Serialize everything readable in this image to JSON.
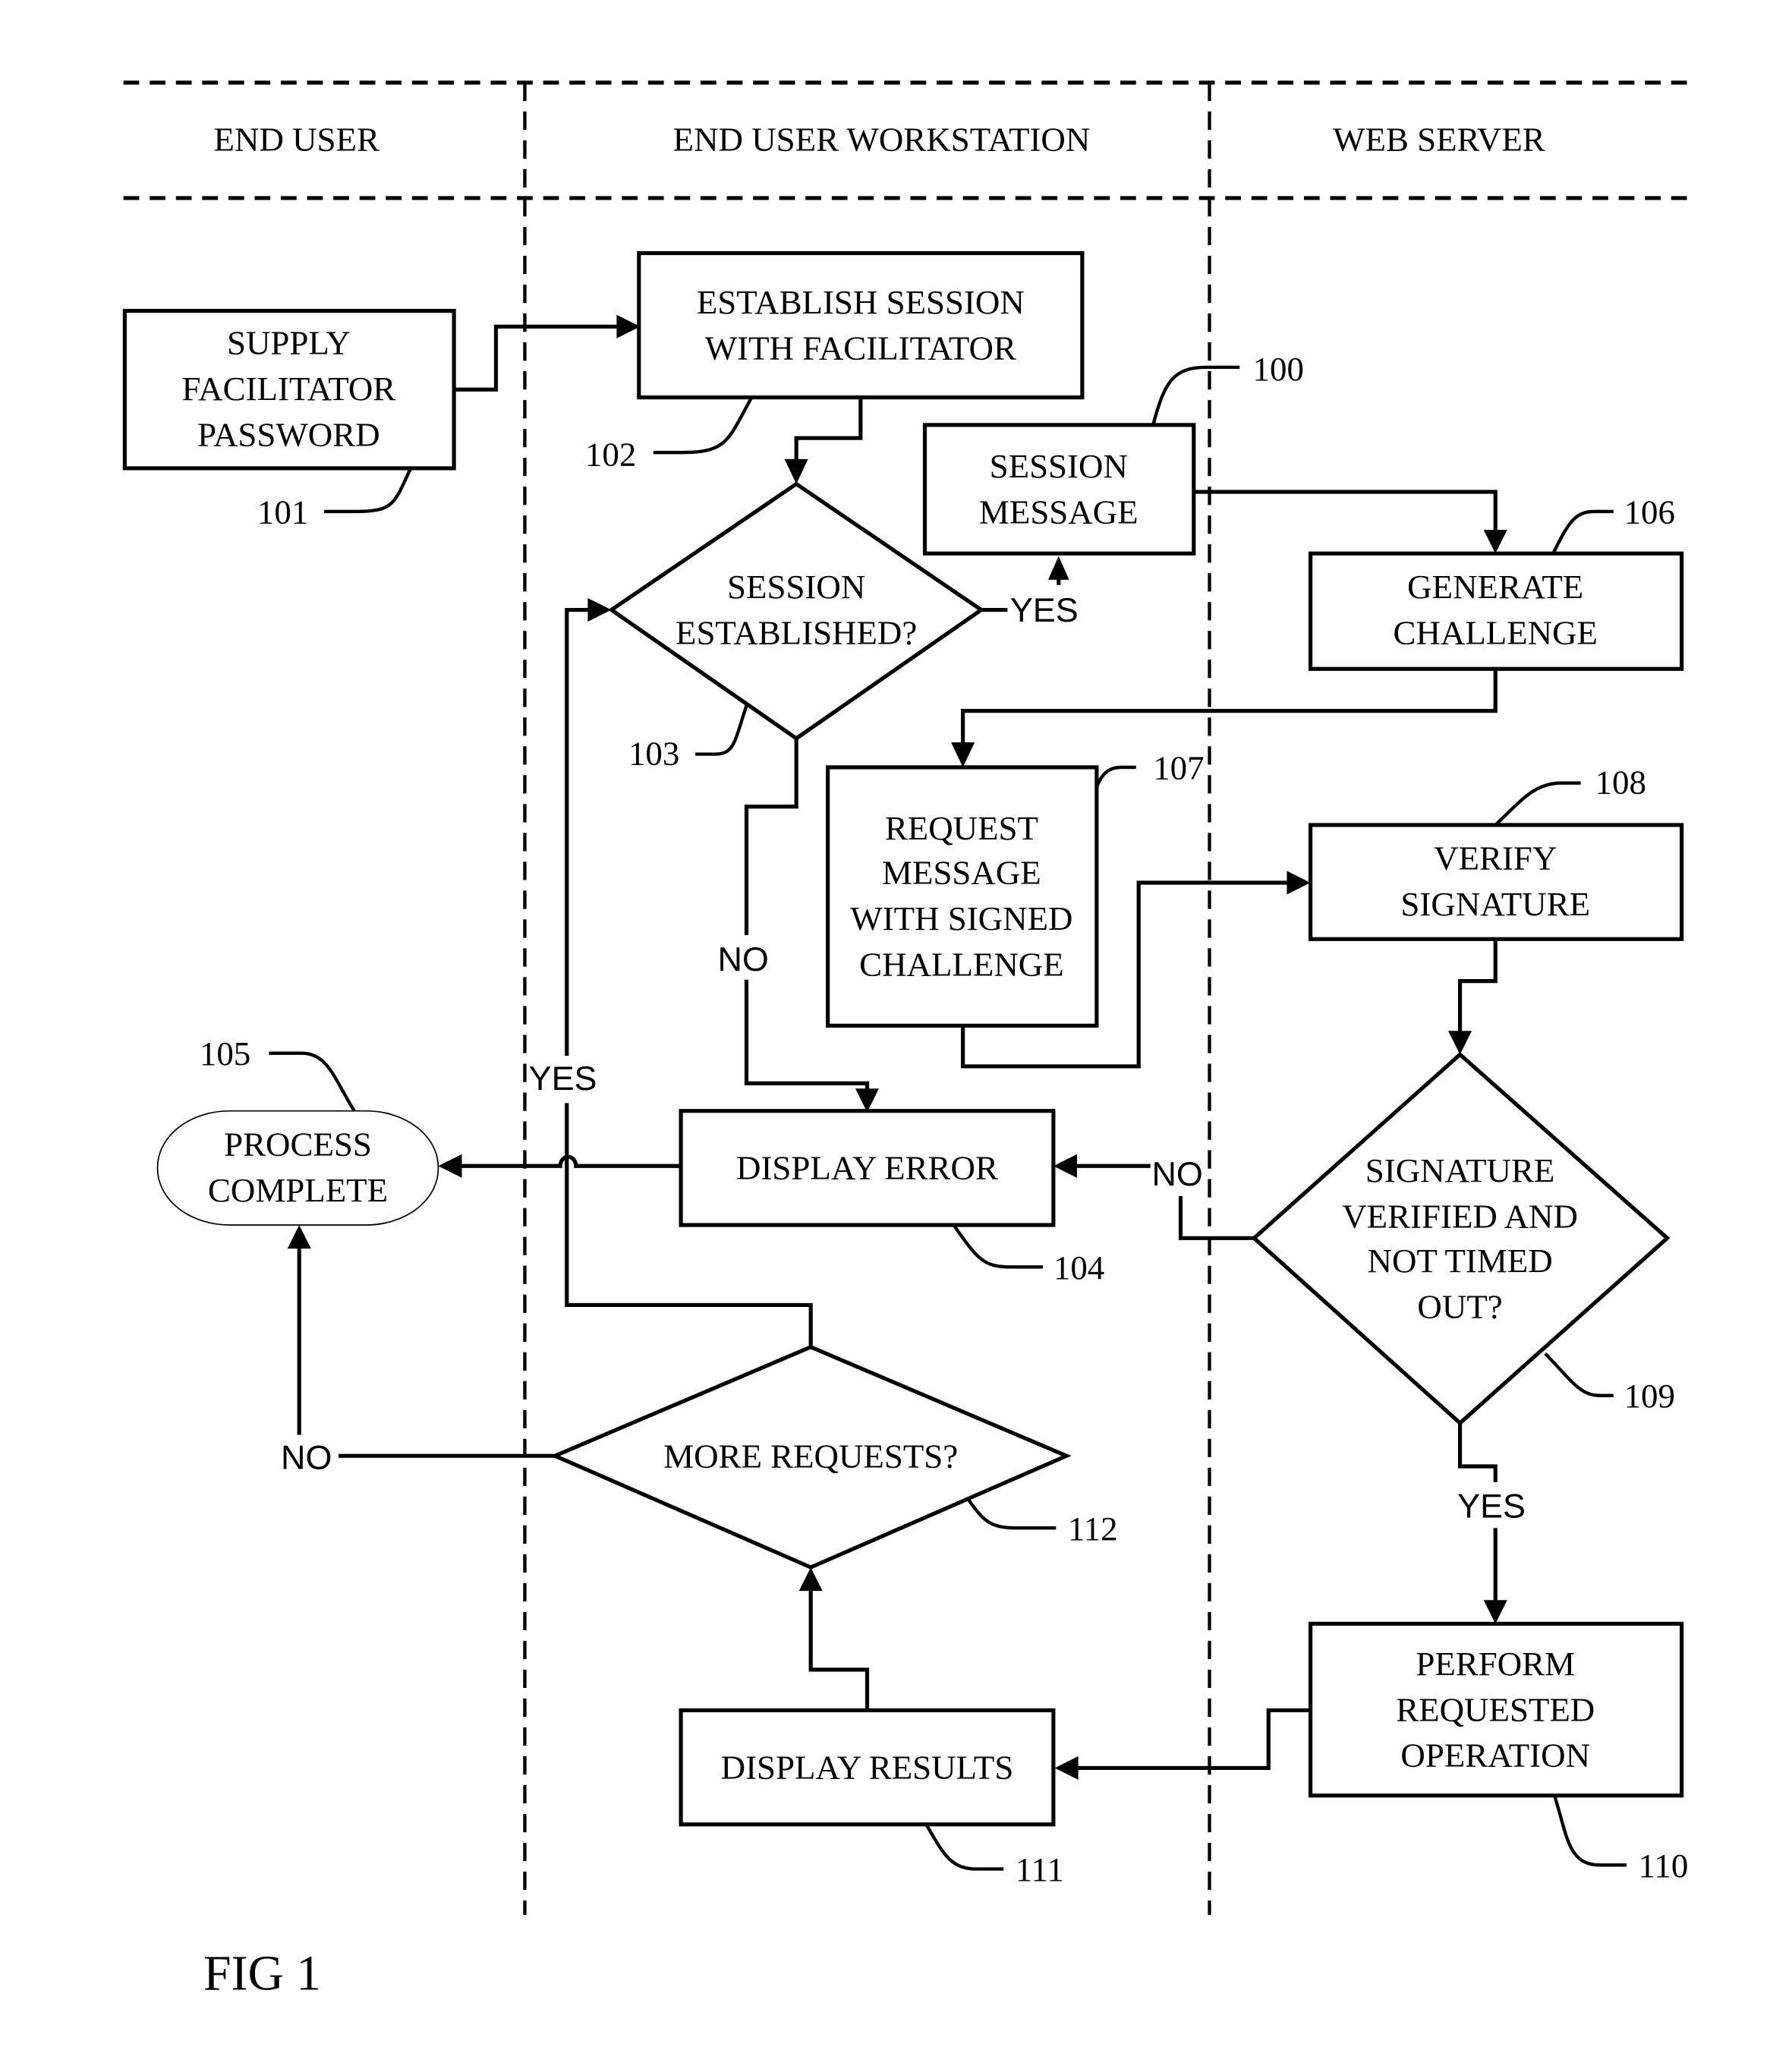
{
  "figure": {
    "caption": "FIG 1",
    "lanes": [
      {
        "id": "end-user",
        "label": "END USER"
      },
      {
        "id": "workstation",
        "label": "END USER WORKSTATION"
      },
      {
        "id": "web-server",
        "label": "WEB SERVER"
      }
    ],
    "nodes": {
      "n101": {
        "ref": "101",
        "type": "process",
        "lines": [
          "SUPPLY",
          "FACILITATOR",
          "PASSWORD"
        ]
      },
      "n102": {
        "ref": "102",
        "type": "process",
        "lines": [
          "ESTABLISH SESSION",
          "WITH FACILITATOR"
        ]
      },
      "n100": {
        "ref": "100",
        "type": "process",
        "lines": [
          "SESSION",
          "MESSAGE"
        ]
      },
      "n103": {
        "ref": "103",
        "type": "decision",
        "lines": [
          "SESSION",
          "ESTABLISHED?"
        ]
      },
      "n106": {
        "ref": "106",
        "type": "process",
        "lines": [
          "GENERATE",
          "CHALLENGE"
        ]
      },
      "n107": {
        "ref": "107",
        "type": "process",
        "lines": [
          "REQUEST",
          "MESSAGE",
          "WITH SIGNED",
          "CHALLENGE"
        ]
      },
      "n108": {
        "ref": "108",
        "type": "process",
        "lines": [
          "VERIFY",
          "SIGNATURE"
        ]
      },
      "n105": {
        "ref": "105",
        "type": "terminal",
        "lines": [
          "PROCESS",
          "COMPLETE"
        ]
      },
      "n104": {
        "ref": "104",
        "type": "process",
        "lines": [
          "DISPLAY ERROR"
        ]
      },
      "n109": {
        "ref": "109",
        "type": "decision",
        "lines": [
          "SIGNATURE",
          "VERIFIED AND",
          "NOT TIMED",
          "OUT?"
        ]
      },
      "n112": {
        "ref": "112",
        "type": "decision",
        "lines": [
          "MORE REQUESTS?"
        ]
      },
      "n110": {
        "ref": "110",
        "type": "process",
        "lines": [
          "PERFORM",
          "REQUESTED",
          "OPERATION"
        ]
      },
      "n111": {
        "ref": "111",
        "type": "process",
        "lines": [
          "DISPLAY RESULTS"
        ]
      }
    },
    "edge_labels": {
      "e103_yes": "YES",
      "e103_no": "NO",
      "e109_no": "NO",
      "e109_yes": "YES",
      "e112_yes": "YES",
      "e112_no": "NO"
    },
    "edges": [
      {
        "from": "101",
        "to": "102"
      },
      {
        "from": "102",
        "to": "103"
      },
      {
        "from": "103",
        "to": "100",
        "label": "YES"
      },
      {
        "from": "103",
        "to": "104",
        "label": "NO"
      },
      {
        "from": "100",
        "to": "106"
      },
      {
        "from": "106",
        "to": "107"
      },
      {
        "from": "107",
        "to": "108"
      },
      {
        "from": "108",
        "to": "109"
      },
      {
        "from": "109",
        "to": "104",
        "label": "NO"
      },
      {
        "from": "109",
        "to": "110",
        "label": "YES"
      },
      {
        "from": "104",
        "to": "105"
      },
      {
        "from": "110",
        "to": "111"
      },
      {
        "from": "111",
        "to": "112"
      },
      {
        "from": "112",
        "to": "103",
        "label": "YES"
      },
      {
        "from": "112",
        "to": "105",
        "label": "NO"
      }
    ]
  }
}
